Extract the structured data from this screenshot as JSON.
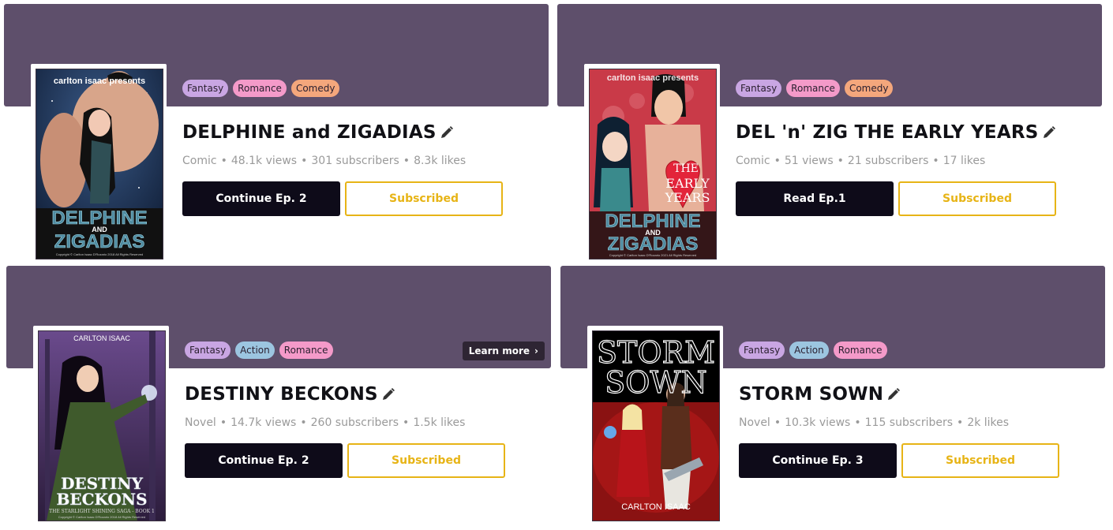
{
  "colors": {
    "banner": "#5e4f6b",
    "fantasy": "#c9a6e3",
    "romance": "#f49ac9",
    "comedy": "#f4a77c",
    "action": "#9cc5e0",
    "primary_button": "#0e0b19",
    "subscribed": "#e7b416"
  },
  "cards": [
    {
      "tags": [
        "Fantasy",
        "Romance",
        "Comedy"
      ],
      "title": "DELPHINE and ZIGADIAS",
      "type": "Comic",
      "views": "48.1k views",
      "subscribers": "301 subscribers",
      "likes": "8.3k likes",
      "primary_label": "Continue Ep. 2",
      "subscribed_label": "Subscribed",
      "cover": {
        "top_text": "carlton isaac presents",
        "line1": "DELPHINE",
        "line2": "AND",
        "line3": "ZIGADIAS",
        "copyright": "Copyright © Carlton Isaac D'Rozario 2018 All Rights Reserved"
      }
    },
    {
      "tags": [
        "Fantasy",
        "Romance",
        "Comedy"
      ],
      "title": "DEL 'n' ZIG THE EARLY YEARS",
      "type": "Comic",
      "views": "51 views",
      "subscribers": "21 subscribers",
      "likes": "17 likes",
      "primary_label": "Read Ep.1",
      "subscribed_label": "Subscribed",
      "cover": {
        "top_text": "carlton isaac presents",
        "heart1": "THE",
        "heart2": "EARLY",
        "heart3": "YEARS",
        "line1": "DELPHINE",
        "line2": "AND",
        "line3": "ZIGADIAS",
        "copyright": "Copyright © Carlton Isaac D'Rozario 2021 All Rights Reserved"
      }
    },
    {
      "tags": [
        "Fantasy",
        "Action",
        "Romance"
      ],
      "title": "DESTINY BECKONS",
      "type": "Novel",
      "views": "14.7k views",
      "subscribers": "260 subscribers",
      "likes": "1.5k likes",
      "primary_label": "Continue Ep. 2",
      "subscribed_label": "Subscribed",
      "learn_more": "Learn more",
      "cover": {
        "top_text": "CARLTON ISAAC",
        "line1": "DESTINY",
        "line2": "BECKONS",
        "line3": "THE STARLIGHT SHINING SAGA - BOOK 1",
        "copyright": "Copyright © Carlton Isaac D'Rozario 2018 All Rights Reserved"
      }
    },
    {
      "tags": [
        "Fantasy",
        "Action",
        "Romance"
      ],
      "title": "STORM SOWN",
      "type": "Novel",
      "views": "10.3k views",
      "subscribers": "115 subscribers",
      "likes": "2k likes",
      "primary_label": "Continue Ep. 3",
      "subscribed_label": "Subscribed",
      "cover": {
        "line1": "STORM",
        "line2": "SOWN",
        "bottom_text": "CARLTON ISAAC"
      }
    }
  ]
}
